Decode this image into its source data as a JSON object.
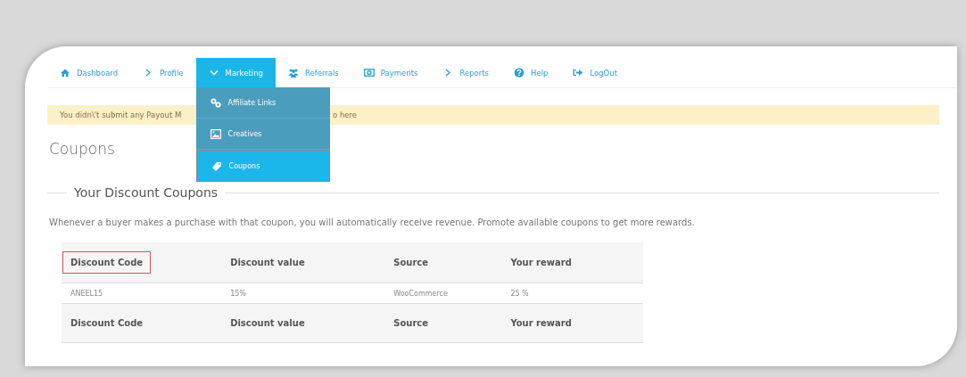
{
  "nav": [
    {
      "label": "Dashboard",
      "kind": "house",
      "selected": false
    },
    {
      "label": "Profile",
      "kind": "chevron",
      "selected": false
    },
    {
      "label": "Marketing",
      "kind": "chevron-down",
      "selected": true
    },
    {
      "label": "Referrals",
      "kind": "people",
      "selected": false
    },
    {
      "label": "Payments",
      "kind": "money",
      "selected": false
    },
    {
      "label": "Reports",
      "kind": "chevron",
      "selected": false
    },
    {
      "label": "Help",
      "kind": "question",
      "selected": false
    },
    {
      "label": "LogOut",
      "kind": "signout",
      "selected": false
    }
  ],
  "dropdown": [
    {
      "label": "Affiliate Links",
      "kind": "link",
      "selected": false
    },
    {
      "label": "Creatives",
      "kind": "picture",
      "selected": false
    },
    {
      "label": "Coupons",
      "kind": "tag",
      "selected": true
    }
  ],
  "alert": {
    "text_start": "You didn\\'t submit any Payout M",
    "text_end": "o here"
  },
  "page_title": "Coupons",
  "section": {
    "legend": "Your Discount Coupons",
    "description": "Whenever a buyer makes a purchase with that coupon, you will automatically receive revenue. Promote available coupons to get more rewards."
  },
  "table": {
    "columns": [
      {
        "label": "Discount Code",
        "highlighted": true
      },
      {
        "label": "Discount value",
        "highlighted": false
      },
      {
        "label": "Source",
        "highlighted": false
      },
      {
        "label": "Your reward",
        "highlighted": false
      }
    ],
    "rows": [
      [
        "ANEEL15",
        "15%",
        "WooCommerce",
        "25 %"
      ]
    ],
    "footer": [
      "Discount Code",
      "Discount value",
      "Source",
      "Your reward"
    ]
  }
}
